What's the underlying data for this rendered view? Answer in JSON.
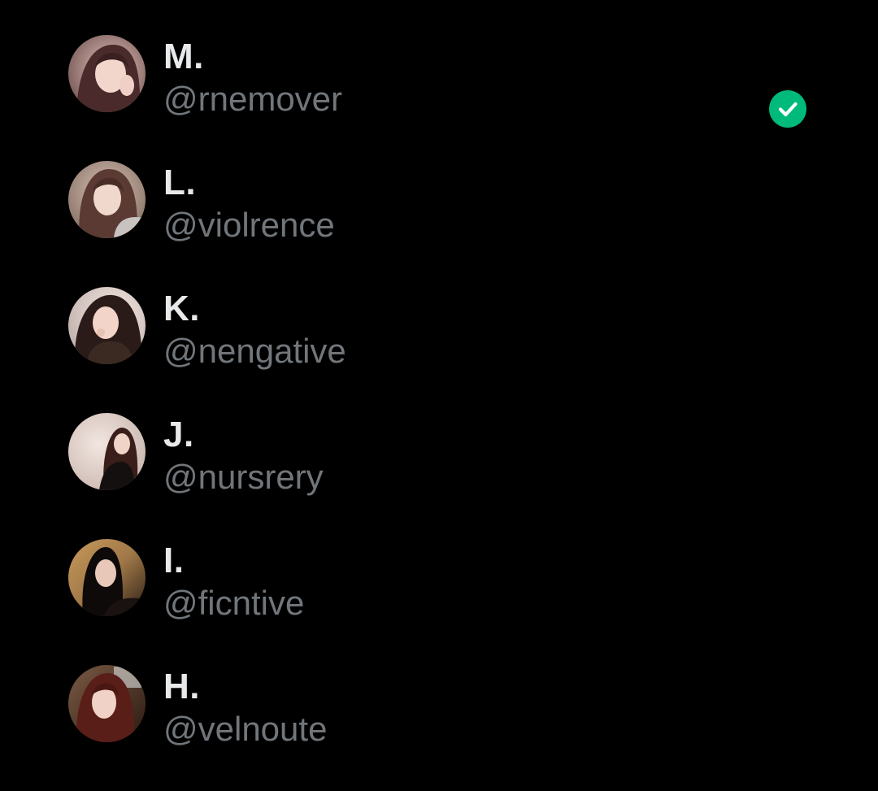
{
  "accent_color": "#00ba7c",
  "accounts": [
    {
      "name": "M.",
      "handle": "@rnemover",
      "selected": true,
      "avatar_icon": "user-avatar"
    },
    {
      "name": "L.",
      "handle": "@violrence",
      "selected": false,
      "avatar_icon": "user-avatar"
    },
    {
      "name": "K.",
      "handle": "@nengative",
      "selected": false,
      "avatar_icon": "user-avatar"
    },
    {
      "name": "J.",
      "handle": "@nursrery",
      "selected": false,
      "avatar_icon": "user-avatar"
    },
    {
      "name": "I.",
      "handle": "@ficntive",
      "selected": false,
      "avatar_icon": "user-avatar"
    },
    {
      "name": "H.",
      "handle": "@velnoute",
      "selected": false,
      "avatar_icon": "user-avatar"
    }
  ],
  "selected_icon": "checkmark-circle-icon"
}
